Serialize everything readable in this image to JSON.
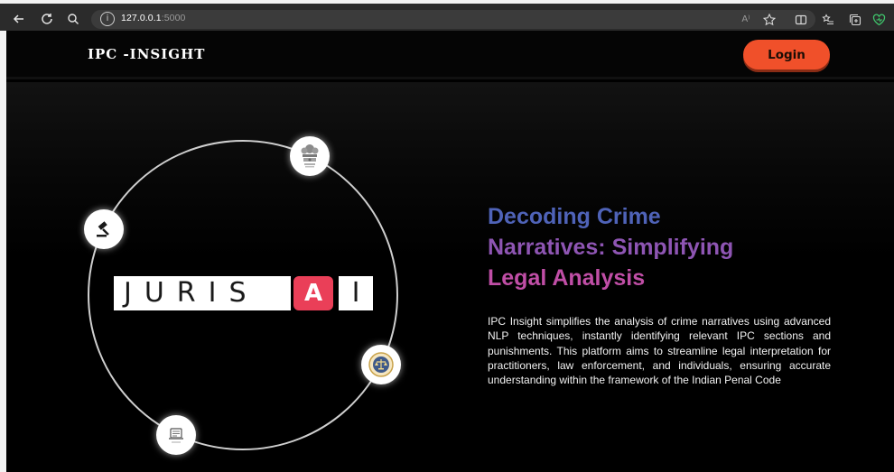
{
  "browser": {
    "url_host": "127.0.0.1",
    "url_port": ":5000",
    "read_aloud_label": "A⁾"
  },
  "header": {
    "brand": "IPC -INSIGHT",
    "login_label": "Login"
  },
  "logo": {
    "main_text": "JURIS",
    "highlight_text": "A",
    "tail_text": "I"
  },
  "hero": {
    "headline_line1": "Decoding Crime",
    "headline_line2": "Narratives: Simplifying",
    "headline_line3": "Legal Analysis",
    "description": "IPC Insight simplifies the analysis of crime narratives using advanced NLP techniques, instantly identifying relevant IPC sections and punishments. This platform aims to streamline legal interpretation for practitioners, law enforcement, and individuals, ensuring accurate understanding within the framework of the Indian Penal Code"
  },
  "badges": [
    "emblem-icon",
    "gavel-icon",
    "scales-icon",
    "document-icon"
  ],
  "colors": {
    "accent": "#f0502a",
    "headline_blue": "#4f63b8",
    "headline_violet": "#8e55b3",
    "headline_magenta": "#c04ea6",
    "logo_red": "#ea3f58"
  }
}
